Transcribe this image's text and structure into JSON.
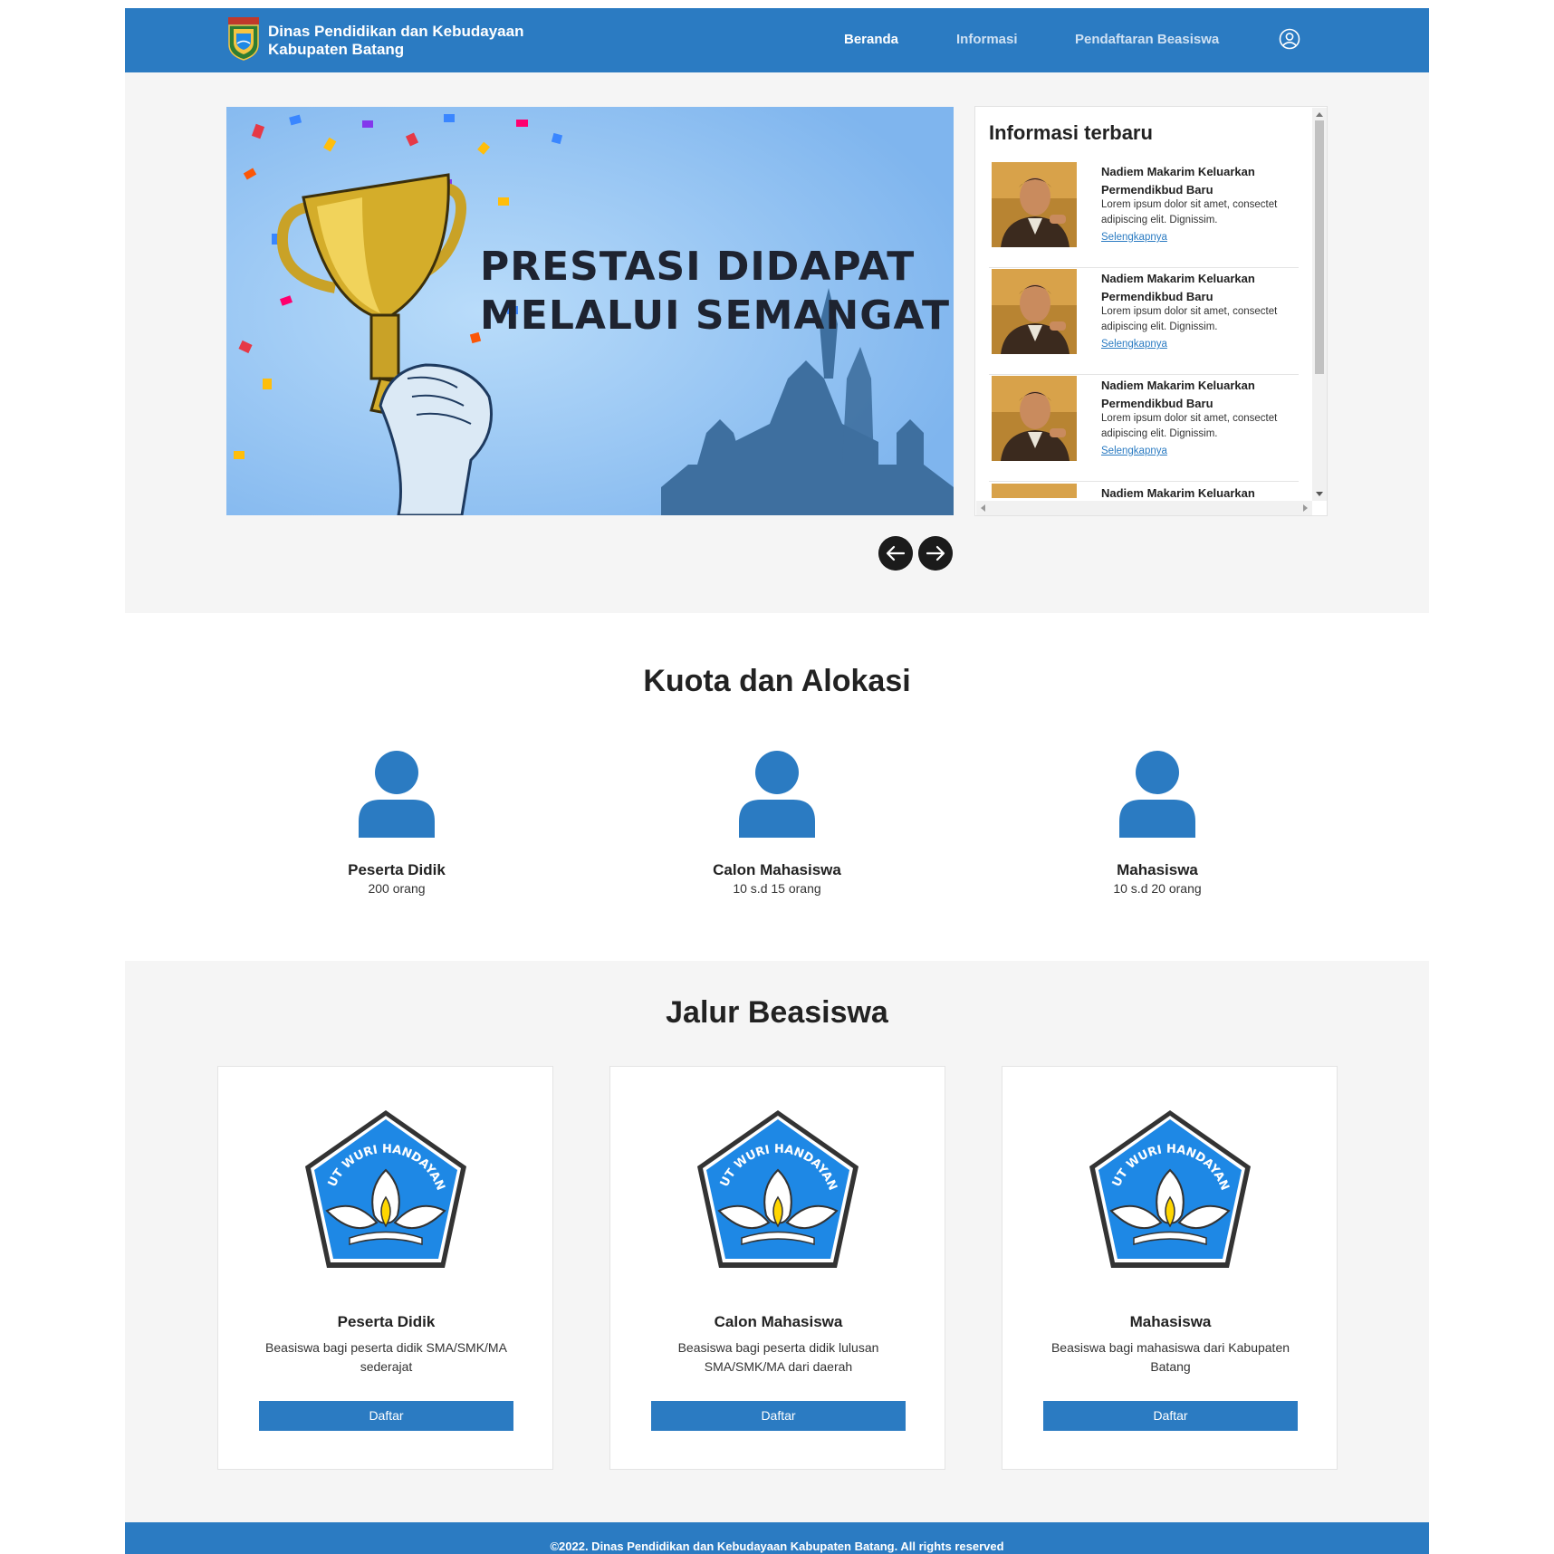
{
  "brand": {
    "line1": "Dinas Pendidikan dan Kebudayaan",
    "line2": "Kabupaten Batang",
    "logo_icon": "batang-regency-crest-icon",
    "logo_text": "BATANG"
  },
  "nav": {
    "links": [
      {
        "label": "Beranda",
        "active": true
      },
      {
        "label": "Informasi",
        "active": false
      },
      {
        "label": "Pendaftaran Beasiswa",
        "active": false
      }
    ],
    "user_icon": "user-circle-icon"
  },
  "banner": {
    "line1": "PRESTASI DIDAPAT",
    "line2": "MELALUI SEMANGAT",
    "prev_icon": "arrow-left-icon",
    "next_icon": "arrow-right-icon"
  },
  "news": {
    "title": "Informasi terbaru",
    "items": [
      {
        "headline": "Nadiem Makarim Keluarkan Permendikbud Baru",
        "excerpt": "Lorem ipsum dolor sit amet, consectet adipiscing elit. Dignissim.",
        "link": "Selengkapnya"
      },
      {
        "headline": "Nadiem Makarim Keluarkan Permendikbud Baru",
        "excerpt": "Lorem ipsum dolor sit amet, consectet adipiscing elit. Dignissim.",
        "link": "Selengkapnya"
      },
      {
        "headline": "Nadiem Makarim Keluarkan Permendikbud Baru",
        "excerpt": "Lorem ipsum dolor sit amet, consectet adipiscing elit. Dignissim.",
        "link": "Selengkapnya"
      },
      {
        "headline": "Nadiem Makarim Keluarkan",
        "excerpt": "",
        "link": ""
      }
    ]
  },
  "kuota": {
    "title": "Kuota dan Alokasi",
    "items": [
      {
        "name": "Peserta Didik",
        "value": "200 orang",
        "icon": "user-icon"
      },
      {
        "name": "Calon Mahasiswa",
        "value": "10 s.d 15 orang",
        "icon": "user-icon"
      },
      {
        "name": "Mahasiswa",
        "value": "10 s.d 20 orang",
        "icon": "user-icon"
      }
    ]
  },
  "jalur": {
    "title": "Jalur Beasiswa",
    "logo_text": "TUT WURI HANDAYANI",
    "cards": [
      {
        "title": "Peserta Didik",
        "desc": "Beasiswa bagi peserta didik SMA/SMK/MA sederajat",
        "button": "Daftar"
      },
      {
        "title": "Calon Mahasiswa",
        "desc": "Beasiswa bagi peserta didik lulusan SMA/SMK/MA dari daerah",
        "button": "Daftar"
      },
      {
        "title": "Mahasiswa",
        "desc": "Beasiswa bagi mahasiswa dari Kabupaten Batang",
        "button": "Daftar"
      }
    ]
  },
  "footer": {
    "text": "©2022. Dinas Pendidikan dan Kebudayaan Kabupaten Batang. All rights reserved"
  },
  "colors": {
    "primary": "#2b7bc2",
    "section_bg": "#f5f5f5",
    "banner_bg": "#8fc1f5",
    "dark_button": "#1b1b1b"
  }
}
